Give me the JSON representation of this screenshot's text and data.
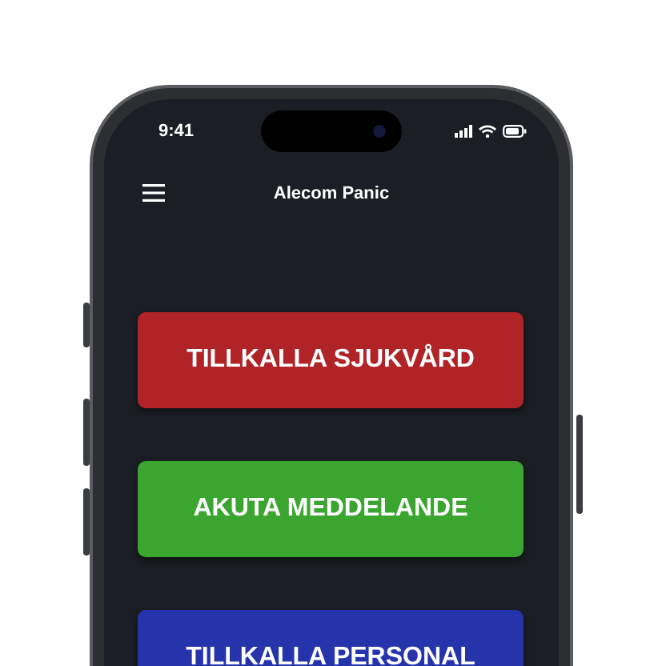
{
  "status_bar": {
    "time": "9:41"
  },
  "app_bar": {
    "title": "Alecom Panic"
  },
  "buttons": [
    {
      "label": "TILLKALLA SJUKVÅRD",
      "color": "#b02427"
    },
    {
      "label": "AKUTA MEDDELANDE",
      "color": "#3aa52f"
    },
    {
      "label": "TILLKALLA PERSONAL",
      "color": "#2634ac"
    }
  ]
}
